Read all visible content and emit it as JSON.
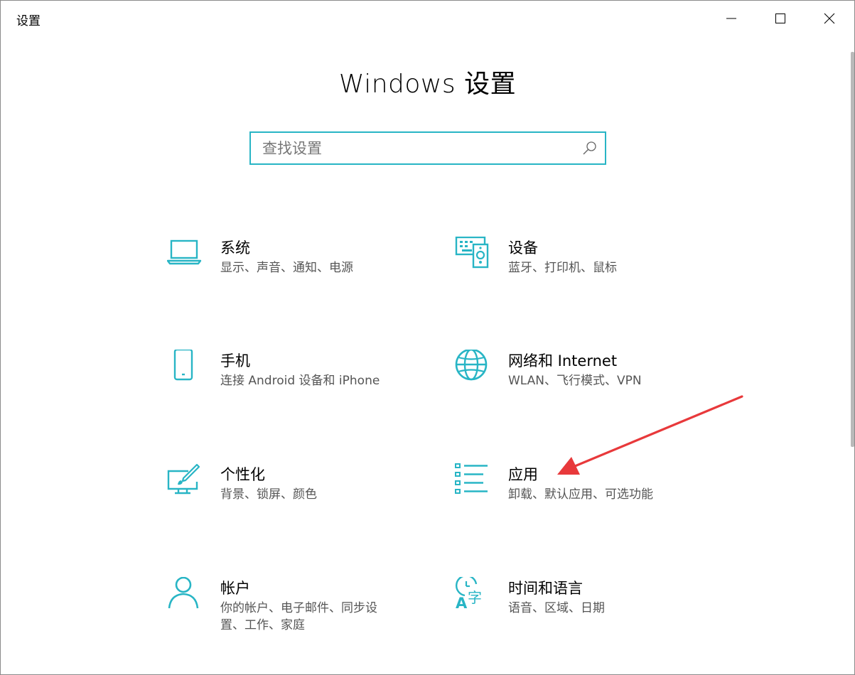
{
  "window": {
    "title": "设置"
  },
  "page": {
    "heading": "Windows 设置"
  },
  "search": {
    "placeholder": "查找设置"
  },
  "tiles": [
    {
      "name": "系统",
      "desc": "显示、声音、通知、电源",
      "icon": "laptop-icon"
    },
    {
      "name": "设备",
      "desc": "蓝牙、打印机、鼠标",
      "icon": "devices-icon"
    },
    {
      "name": "手机",
      "desc": "连接 Android 设备和 iPhone",
      "icon": "phone-icon"
    },
    {
      "name": "网络和 Internet",
      "desc": "WLAN、飞行模式、VPN",
      "icon": "globe-icon"
    },
    {
      "name": "个性化",
      "desc": "背景、锁屏、颜色",
      "icon": "personalization-icon"
    },
    {
      "name": "应用",
      "desc": "卸载、默认应用、可选功能",
      "icon": "apps-list-icon"
    },
    {
      "name": "帐户",
      "desc": "你的帐户、电子邮件、同步设置、工作、家庭",
      "icon": "person-icon"
    },
    {
      "name": "时间和语言",
      "desc": "语音、区域、日期",
      "icon": "time-language-icon"
    }
  ],
  "colors": {
    "accent": "#28b5c5",
    "arrow": "#e8393b"
  }
}
